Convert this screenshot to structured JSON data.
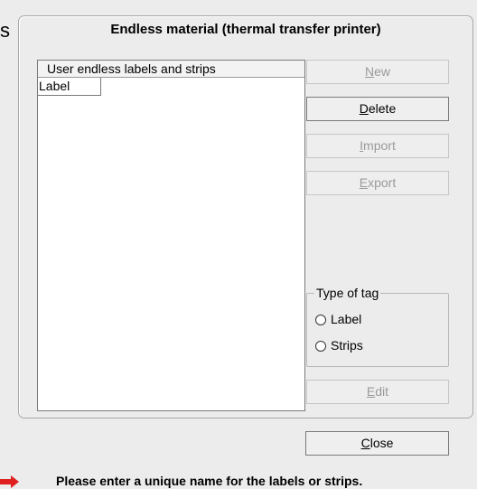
{
  "edge_text": "s",
  "dialog": {
    "title": "Endless material (thermal transfer printer)"
  },
  "list": {
    "header": "User endless labels and strips",
    "items": [
      "Label"
    ]
  },
  "buttons": {
    "new": {
      "mnemonic": "N",
      "rest": "ew",
      "enabled": false
    },
    "delete": {
      "mnemonic": "D",
      "rest": "elete",
      "enabled": true
    },
    "import": {
      "mnemonic": "I",
      "rest": "mport",
      "enabled": false
    },
    "export": {
      "mnemonic": "E",
      "rest": "xport",
      "enabled": false
    },
    "edit": {
      "mnemonic": "E",
      "rest": "dit",
      "enabled": false
    },
    "close": {
      "mnemonic": "C",
      "rest": "lose",
      "enabled": true
    }
  },
  "type_of_tag": {
    "legend": "Type of tag",
    "options": [
      {
        "label": "Label",
        "selected": false
      },
      {
        "label": "Strips",
        "selected": false
      }
    ]
  },
  "status": {
    "message": "Please enter a unique name for the labels or strips.",
    "arrow_color": "#e02020"
  }
}
